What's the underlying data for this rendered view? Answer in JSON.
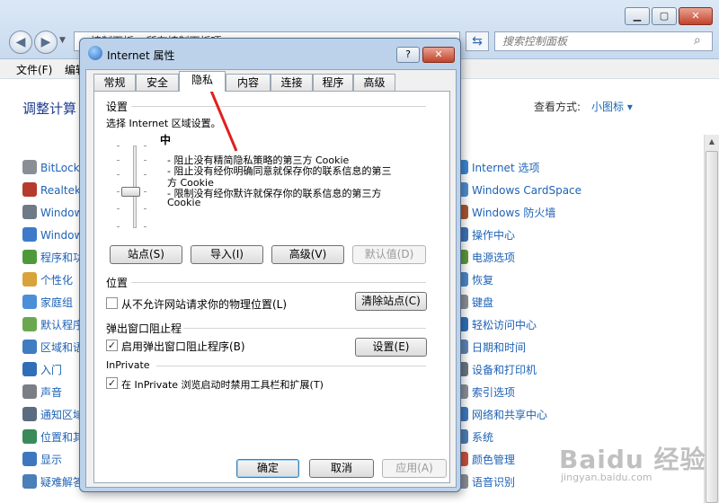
{
  "control_panel": {
    "address": "▸ 控制面板 ▸ 所有控制面板项 ▸",
    "search_placeholder": "搜索控制面板",
    "menu": [
      "文件(F)",
      "编辑"
    ],
    "heading": "调整计算",
    "view_by_label": "查看方式:",
    "view_mode": "小图标 ▾",
    "left_items": [
      "BitLock",
      "Realtek",
      "Window",
      "Window",
      "程序和功",
      "个性化",
      "家庭组",
      "默认程序",
      "区域和语",
      "入门",
      "声音",
      "通知区域",
      "位置和其",
      "显示",
      "疑难解答"
    ],
    "right_items": [
      "Internet 选项",
      "Windows CardSpace",
      "Windows 防火墙",
      "操作中心",
      "电源选项",
      "恢复",
      "键盘",
      "轻松访问中心",
      "日期和时间",
      "设备和打印机",
      "索引选项",
      "网络和共享中心",
      "系统",
      "颜色管理",
      "语音识别"
    ]
  },
  "dialog": {
    "title": "Internet 属性",
    "tabs": [
      "常规",
      "安全",
      "隐私",
      "内容",
      "连接",
      "程序",
      "高级"
    ],
    "active_tab": "隐私",
    "settings": {
      "label": "设置",
      "instruction": "选择 Internet 区域设置。",
      "level": "中",
      "desc_lines": [
        "- 阻止没有精简隐私策略的第三方 Cookie",
        "- 阻止没有经你明确同意就保存你的联系信息的第三",
        "方 Cookie",
        "- 限制没有经你默许就保存你的联系信息的第三方",
        "Cookie"
      ],
      "buttons": [
        "站点(S)",
        "导入(I)",
        "高级(V)",
        "默认值(D)"
      ]
    },
    "location": {
      "label": "位置",
      "checkbox_label": "从不允许网站请求你的物理位置(L)",
      "checked": false,
      "button": "清除站点(C)"
    },
    "popup": {
      "label": "弹出窗口阻止程",
      "checkbox_label": "启用弹出窗口阻止程序(B)",
      "checked": true,
      "button": "设置(E)"
    },
    "inprivate": {
      "label": "InPrivate",
      "checkbox_label": "在 InPrivate 浏览启动时禁用工具栏和扩展(T)",
      "checked": true
    },
    "footer": {
      "ok": "确定",
      "cancel": "取消",
      "apply": "应用(A)"
    }
  },
  "check_mark": "✓",
  "icons": {
    "help": "?",
    "close": "✕",
    "minimize": "▁",
    "maximize": "▢"
  },
  "watermark": {
    "brand": "Baidu 经验",
    "url": "jingyan.baidu.com"
  }
}
